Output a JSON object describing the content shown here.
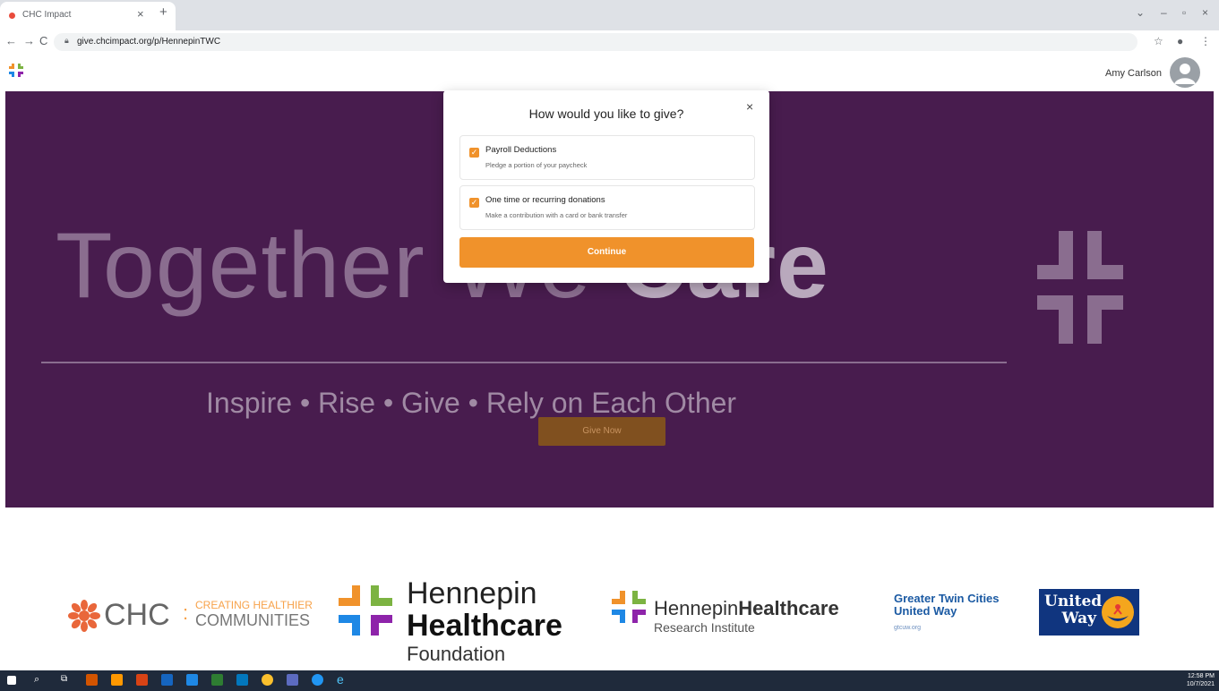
{
  "browser": {
    "tab_title": "CHC Impact",
    "tab_close": "×",
    "new_tab": "+",
    "window_controls": [
      "⌄",
      "–",
      "▫",
      "×"
    ],
    "url": "give.chcimpact.org/p/HennepinTWC",
    "nav": [
      "←",
      "→",
      "C"
    ]
  },
  "header": {
    "user_name": "Amy Carlson"
  },
  "hero": {
    "title_light": "Together We ",
    "title_bold": "Care",
    "subtitle": "Inspire  •  Rise  •  Give  •  Rely on Each Other",
    "give_now": "Give Now"
  },
  "modal": {
    "title": "How would you like to give?",
    "close": "×",
    "options": [
      {
        "title": "Payroll Deductions",
        "desc": "Pledge a portion of your paycheck",
        "checked": true
      },
      {
        "title": "One time or recurring donations",
        "desc": "Make a contribution with a card or bank transfer",
        "checked": true
      }
    ],
    "continue": "Continue"
  },
  "footer": {
    "chc": {
      "name": "CHC",
      "sep": ":",
      "tag1": "CREATING HEALTHIER",
      "tag2": "COMMUNITIES"
    },
    "hhf": {
      "line1": "Hennepin",
      "line2": "Healthcare",
      "line3": "Foundation"
    },
    "hhr": {
      "line1_a": "Hennepin",
      "line1_b": "Healthcare",
      "line2": "Research Institute"
    },
    "gtc": {
      "line1": "Greater Twin Cities",
      "line2": "United Way",
      "url": "gtcuw.org"
    },
    "uw": {
      "line1": "United",
      "line2": "Way"
    }
  },
  "taskbar": {
    "time": "12:58 PM",
    "date": "10/7/2021"
  },
  "colors": {
    "hero_bg": "#481c4e",
    "accent_orange": "#f0922b"
  }
}
